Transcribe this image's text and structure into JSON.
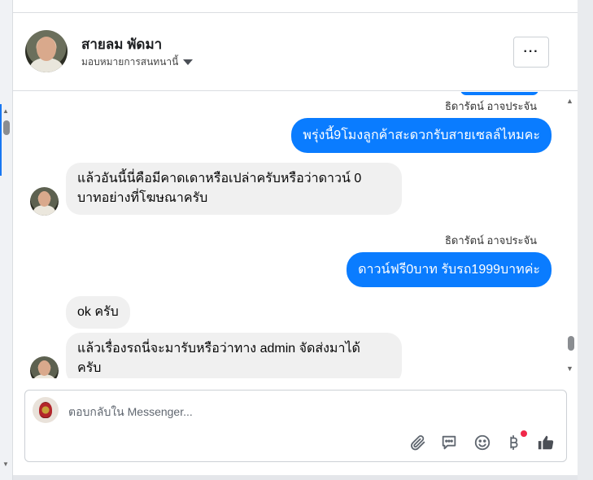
{
  "header": {
    "contact_name": "สายลม พัดมา",
    "assign_label": "มอบหมายการสนทนานี้",
    "more_label": "···"
  },
  "messages": [
    {
      "direction": "out",
      "sender": "ธิดารัตน์ อาจประจัน",
      "text": "พรุ่งนี้9โมงลูกค้าสะดวกรับสายเซลล์ไหมคะ"
    },
    {
      "direction": "in",
      "line1": "แล้วอันนี้นี่คือมีคาดเดาหรือเปล่าครับหรือว่าดาวน์ 0",
      "line2": "บาทอย่างที่โฆษณาครับ"
    },
    {
      "direction": "out",
      "sender": "ธิดารัตน์ อาจประจัน",
      "text": "ดาวน์ฟรี0บาท รับรถ1999บาทค่ะ"
    },
    {
      "direction": "in",
      "text": "ok ครับ"
    },
    {
      "direction": "in",
      "line1": "แล้วเรื่องรถนี่จะมารับหรือว่าทาง admin จัดส่งมาได้",
      "line2": "ครับ"
    }
  ],
  "composer": {
    "placeholder": "ตอบกลับใน Messenger..."
  },
  "tools": [
    "paperclip-icon",
    "saved-reply-icon",
    "emoji-icon",
    "baht-icon",
    "thumbs-up-icon"
  ],
  "colors": {
    "outgoing_bubble": "#0a7cff",
    "incoming_bubble": "#f0f0f0",
    "notification_dot": "#f02849"
  }
}
